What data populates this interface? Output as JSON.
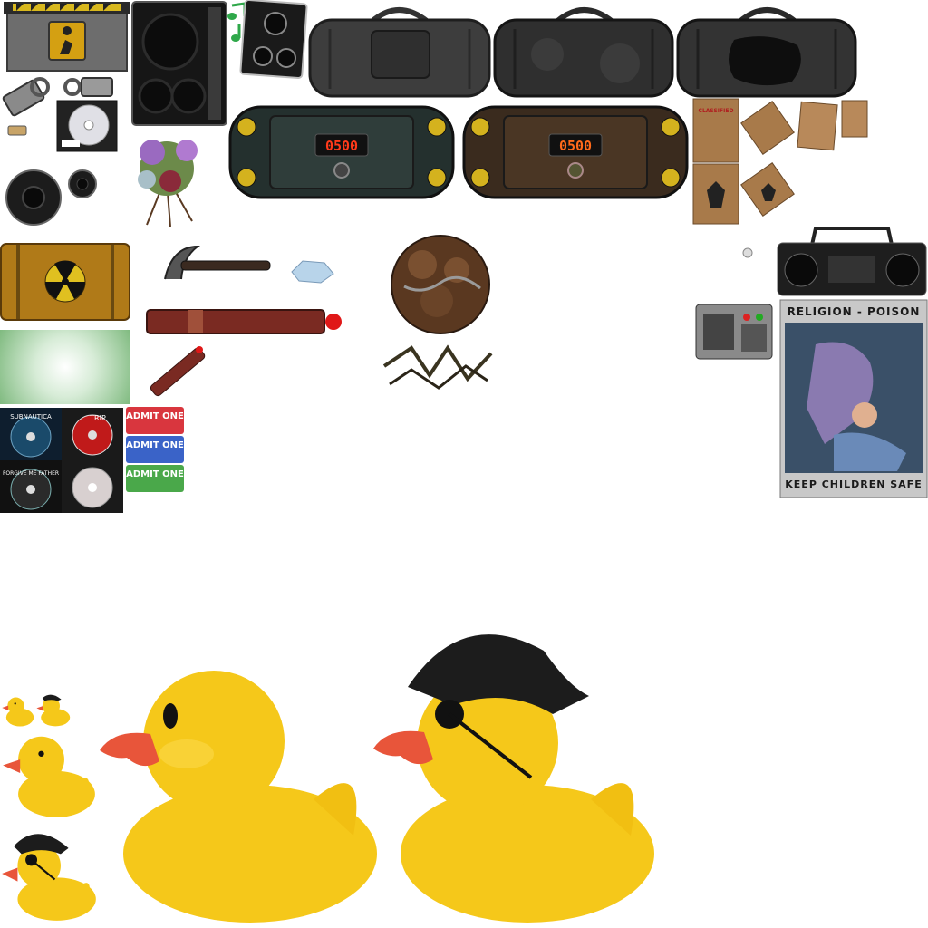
{
  "sprites": {
    "bomb_timer_1": "0500",
    "bomb_timer_2": "0500",
    "folder_label": "CLASSIFIED",
    "poster": {
      "top": "RELIGION - POISON",
      "bottom": "KEEP CHILDREN SAFE"
    },
    "tickets": [
      "ADMIT ONE",
      "ADMIT ONE",
      "ADMIT ONE"
    ],
    "ticket_colors": [
      "#d9363e",
      "#3a63c8",
      "#4aa84a"
    ],
    "cds": [
      {
        "title": "SUBNAUTICA"
      },
      {
        "title": "TRIP"
      },
      {
        "title": "FORGIVE ME FATHER"
      },
      {
        "title": ""
      }
    ],
    "duck_color": "#f5c81a",
    "beak_color": "#e8553a",
    "hat_color": "#1c1c1c"
  }
}
